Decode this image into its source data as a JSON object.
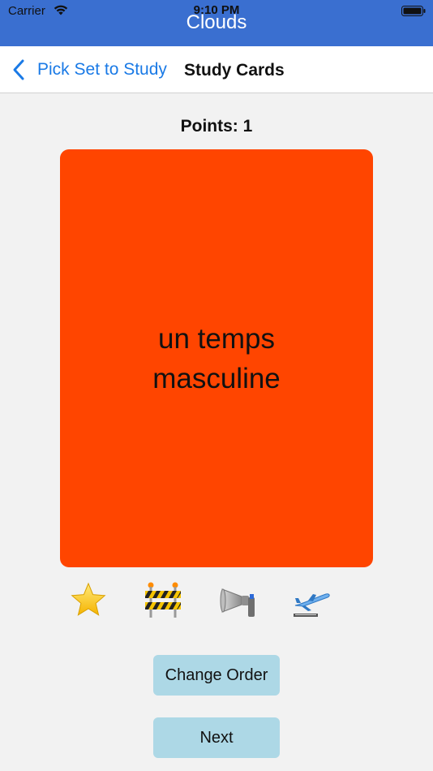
{
  "status_bar": {
    "carrier": "Carrier",
    "time": "9:10 PM"
  },
  "app": {
    "title": "Clouds",
    "accent_color": "#3a6fd0"
  },
  "nav": {
    "back_label": "Pick Set to Study",
    "title": "Study Cards",
    "link_color": "#1a7ae6"
  },
  "points": {
    "label": "Points:",
    "value": "1"
  },
  "card": {
    "lines": [
      "un temps",
      "masculine"
    ],
    "color": "#ff4500"
  },
  "icons": [
    {
      "name": "star-icon"
    },
    {
      "name": "construction-barrier-icon"
    },
    {
      "name": "megaphone-icon"
    },
    {
      "name": "airplane-departure-icon"
    }
  ],
  "buttons": {
    "change_order": "Change Order",
    "next": "Next",
    "color": "#add8e6"
  }
}
